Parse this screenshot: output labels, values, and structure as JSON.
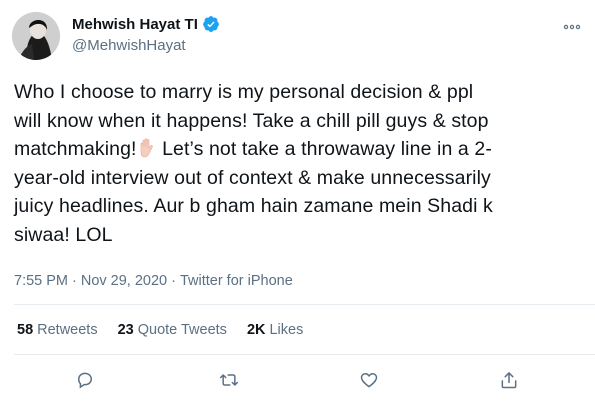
{
  "author": {
    "display_name": "Mehwish Hayat TI",
    "handle": "@MehwishHayat",
    "verified_icon": "verified-badge-icon",
    "avatar": "avatar"
  },
  "tweet": {
    "lines": [
      "Who I choose to marry is my personal decision & ppl",
      "will know when it happens! Take a chill pill guys & stop",
      "matchmaking!",
      " Let’s not take a throwaway line in a 2-",
      "year-old interview out of context & make unnecessarily",
      "juicy headlines. Aur b gham hain zamane mein Shadi k",
      "siwaa! LOL"
    ]
  },
  "meta": {
    "time": "7:55 PM",
    "separator": "·",
    "date": "Nov 29, 2020",
    "source": "Twitter for iPhone"
  },
  "stats": {
    "retweets_count": "58",
    "retweets_label": "Retweets",
    "quotes_count": "23",
    "quotes_label": "Quote Tweets",
    "likes_count": "2K",
    "likes_label": "Likes"
  },
  "colors": {
    "verified": "#1da1f2",
    "secondary_text": "#5b7083",
    "primary_text": "#0f1419",
    "divider": "#e6ecf0"
  }
}
